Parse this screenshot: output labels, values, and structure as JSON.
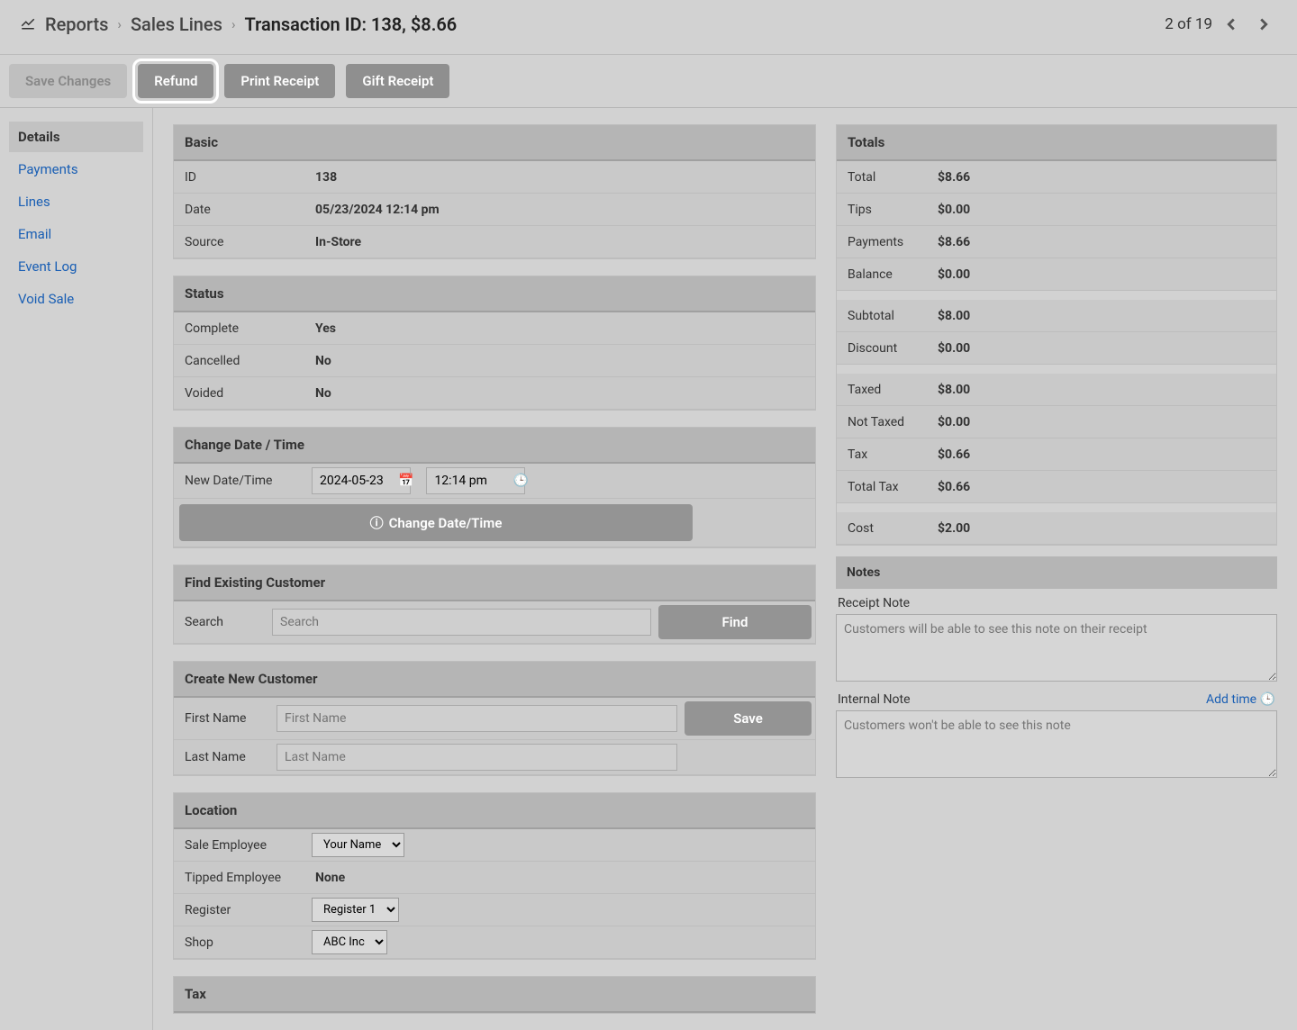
{
  "breadcrumb": {
    "root": "Reports",
    "mid": "Sales Lines",
    "active": "Transaction  ID: 138, $8.66"
  },
  "paging": {
    "label": "2 of 19"
  },
  "toolbar": {
    "save": "Save Changes",
    "refund": "Refund",
    "print": "Print Receipt",
    "gift": "Gift Receipt"
  },
  "sidebar": {
    "details": "Details",
    "payments": "Payments",
    "lines": "Lines",
    "email": "Email",
    "eventlog": "Event Log",
    "voidsale": "Void Sale"
  },
  "basic": {
    "header": "Basic",
    "id_label": "ID",
    "id": "138",
    "date_label": "Date",
    "date": "05/23/2024 12:14 pm",
    "source_label": "Source",
    "source": "In-Store"
  },
  "status": {
    "header": "Status",
    "complete_label": "Complete",
    "complete": "Yes",
    "cancelled_label": "Cancelled",
    "cancelled": "No",
    "voided_label": "Voided",
    "voided": "No"
  },
  "changedt": {
    "header": "Change Date / Time",
    "new_label": "New Date/Time",
    "date_value": "2024-05-23",
    "time_value": "12:14 pm",
    "button": "Change Date/Time"
  },
  "findcust": {
    "header": "Find Existing Customer",
    "search_label": "Search",
    "search_placeholder": "Search",
    "find_btn": "Find"
  },
  "newcust": {
    "header": "Create New Customer",
    "fn_label": "First Name",
    "fn_placeholder": "First Name",
    "ln_label": "Last Name",
    "ln_placeholder": "Last Name",
    "save_btn": "Save"
  },
  "location": {
    "header": "Location",
    "sale_emp_label": "Sale Employee",
    "sale_emp": "Your Name",
    "tip_emp_label": "Tipped Employee",
    "tip_emp": "None",
    "register_label": "Register",
    "register": "Register 1",
    "shop_label": "Shop",
    "shop": "ABC Inc"
  },
  "tax": {
    "header": "Tax"
  },
  "totals": {
    "header": "Totals",
    "total_label": "Total",
    "total": "$8.66",
    "tips_label": "Tips",
    "tips": "$0.00",
    "payments_label": "Payments",
    "payments": "$8.66",
    "balance_label": "Balance",
    "balance": "$0.00",
    "subtotal_label": "Subtotal",
    "subtotal": "$8.00",
    "discount_label": "Discount",
    "discount": "$0.00",
    "taxed_label": "Taxed",
    "taxed": "$8.00",
    "nottaxed_label": "Not Taxed",
    "nottaxed": "$0.00",
    "tax_label": "Tax",
    "tax": "$0.66",
    "totaltax_label": "Total Tax",
    "totaltax": "$0.66",
    "cost_label": "Cost",
    "cost": "$2.00"
  },
  "notes": {
    "header": "Notes",
    "receipt_label": "Receipt Note",
    "receipt_placeholder": "Customers will be able to see this note on their receipt",
    "internal_label": "Internal Note",
    "addtime": "Add time",
    "internal_placeholder": "Customers won't be able to see this note"
  }
}
